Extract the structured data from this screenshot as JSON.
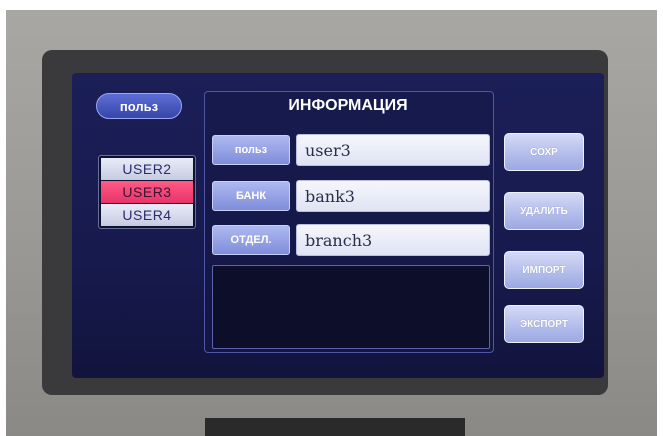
{
  "screen": {
    "user_label_button": "польз",
    "users": [
      {
        "label": "USER2",
        "selected": false
      },
      {
        "label": "USER3",
        "selected": true
      },
      {
        "label": "USER4",
        "selected": false
      }
    ],
    "info": {
      "title": "ИНФОРМАЦИЯ",
      "fields": [
        {
          "label": "польз",
          "value": "user3"
        },
        {
          "label": "БАНК",
          "value": "bank3"
        },
        {
          "label": "ОТДЕЛ.",
          "value": "branch3"
        }
      ]
    },
    "actions": {
      "save": "СОХР",
      "delete": "УДАЛИТЬ",
      "import": "ИМПОРТ",
      "export": "ЭКСПОРТ"
    }
  },
  "colors": {
    "screen_bg": "#1b1f57",
    "selected_item": "#ff5a84",
    "button_face": "#b4bdee"
  }
}
